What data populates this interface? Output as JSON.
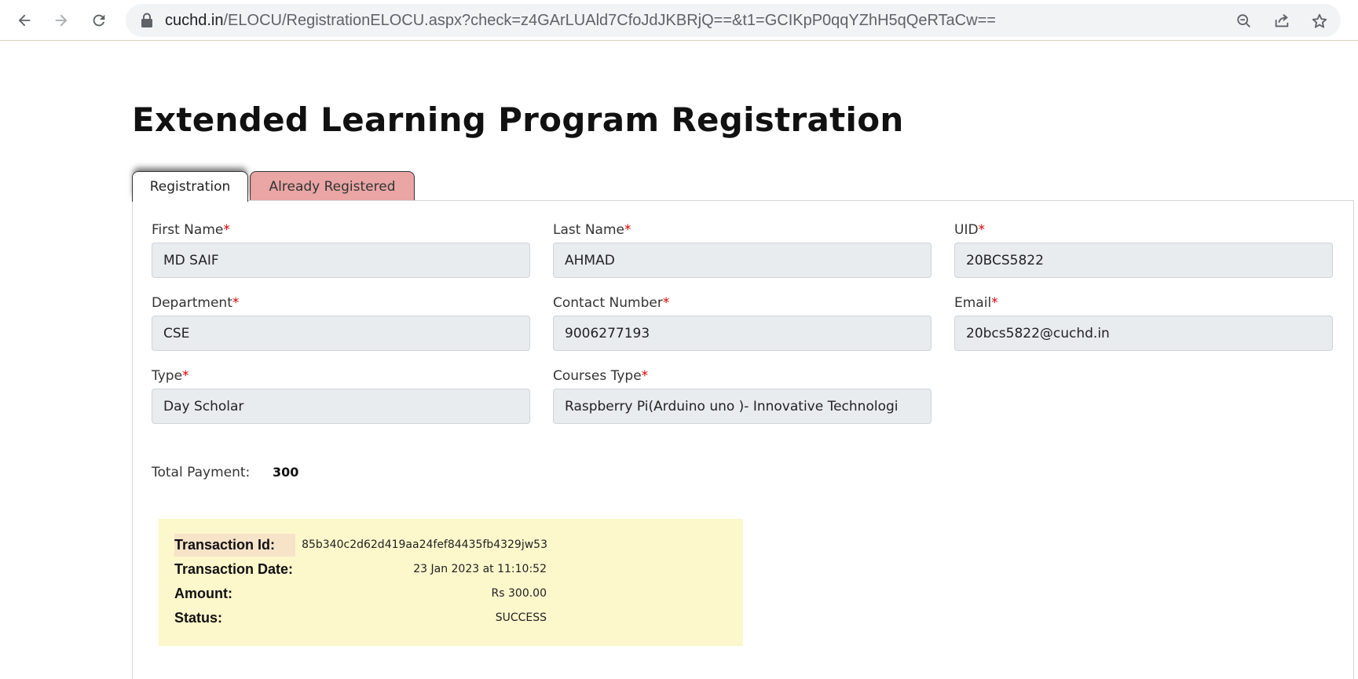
{
  "browser": {
    "url_host": "cuchd.in",
    "url_path": "/ELOCU/RegistrationELOCU.aspx?check=z4GArLUAld7CfoJdJKBRjQ==&t1=GCIKpP0qqYZhH5qQeRTaCw==",
    "icons": [
      "back-arrow-icon",
      "forward-arrow-icon",
      "reload-icon",
      "lock-icon",
      "zoom-out-icon",
      "share-icon",
      "star-icon"
    ]
  },
  "page": {
    "title": "Extended Learning Program Registration"
  },
  "tabs": {
    "registration": "Registration",
    "already_registered": "Already Registered"
  },
  "colors": {
    "tab_inactive_bg": "#eaa5a5",
    "required_marker": "#dd0000",
    "transaction_bg": "#fdf7cc"
  },
  "form": {
    "required_marker": "*",
    "first_name": {
      "label": "First Name",
      "value": "MD SAIF"
    },
    "last_name": {
      "label": "Last Name",
      "value": "AHMAD"
    },
    "uid": {
      "label": "UID",
      "value": "20BCS5822"
    },
    "department": {
      "label": "Department",
      "value": "CSE"
    },
    "contact_number": {
      "label": "Contact Number",
      "value": "9006277193"
    },
    "email": {
      "label": "Email",
      "value": "20bcs5822@cuchd.in"
    },
    "type": {
      "label": "Type",
      "value": "Day Scholar"
    },
    "courses_type": {
      "label": "Courses Type",
      "value": "Raspberry Pi(Arduino uno )- Innovative Technologi"
    }
  },
  "payment": {
    "total_label": "Total Payment:",
    "total_value": "300"
  },
  "transaction": {
    "id_label": "Transaction Id:",
    "id_value": "85b340c2d62d419aa24fef84435fb4329jw53",
    "date_label": "Transaction Date:",
    "date_value": "23 Jan 2023 at 11:10:52",
    "amount_label": "Amount:",
    "amount_value": "Rs 300.00",
    "status_label": "Status:",
    "status_value": "SUCCESS"
  }
}
